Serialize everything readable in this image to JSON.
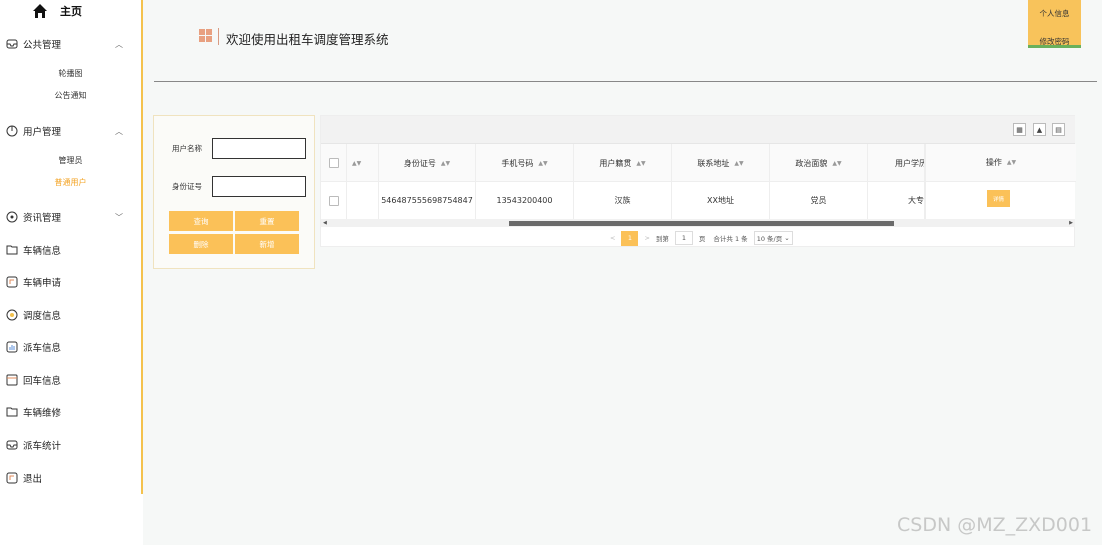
{
  "sidebar": {
    "home_label": "主页",
    "menus": [
      {
        "label": "公共管理",
        "icon": "inbox-icon",
        "chevron": "︿",
        "sub": [
          "轮播图",
          "公告通知"
        ]
      },
      {
        "label": "用户管理",
        "icon": "clock-icon",
        "chevron": "︿",
        "sub": [
          "管理员",
          "普通用户"
        ]
      },
      {
        "label": "资讯管理",
        "icon": "info-circle-icon",
        "chevron": "﹀"
      },
      {
        "label": "车辆信息",
        "icon": "folder-icon"
      },
      {
        "label": "车辆申请",
        "icon": "bookmark-icon"
      },
      {
        "label": "调度信息",
        "icon": "dial-icon"
      },
      {
        "label": "派车信息",
        "icon": "bar-chart-icon"
      },
      {
        "label": "回车信息",
        "icon": "browser-icon"
      },
      {
        "label": "车辆维修",
        "icon": "folder-icon"
      },
      {
        "label": "派车统计",
        "icon": "inbox-icon"
      },
      {
        "label": "退出",
        "icon": "bookmark-icon"
      }
    ]
  },
  "header": {
    "title": "欢迎使用出租车调度管理系统",
    "profile_label": "个人信息",
    "password_label": "修改密码"
  },
  "search": {
    "username_label": "用户名称",
    "idcard_label": "身份证号",
    "query_btn": "查询",
    "reset_btn": "重置",
    "delete_btn": "删除",
    "add_btn": "新增"
  },
  "table": {
    "columns": [
      "身份证号",
      "手机号码",
      "用户籍贯",
      "联系地址",
      "政治面貌",
      "用户学历",
      "操作"
    ],
    "rows": [
      {
        "idcard": "546487555698754847",
        "phone": "13543200400",
        "origin": "汉族",
        "address": "XX地址",
        "politics": "党员",
        "education": "大专",
        "action": "详情"
      }
    ]
  },
  "pager": {
    "prev": "<",
    "current": "1",
    "next": ">",
    "goto_label": "到第",
    "goto_value": "1",
    "page_unit": "页",
    "total_text": "合计共 1 条",
    "page_size": "10 条/页"
  },
  "watermark": "CSDN @MZ_ZXD001",
  "colors": {
    "accent": "#fbc158",
    "active": "#f3a324",
    "sidebar_border": "#f4c24d"
  }
}
